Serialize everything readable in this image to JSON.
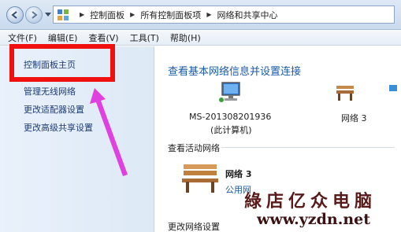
{
  "address_bar": {
    "crumbs": [
      "控制面板",
      "所有控制面板项",
      "网络和共享中心"
    ]
  },
  "menu": [
    "文件(F)",
    "编辑(E)",
    "查看(V)",
    "工具(T)",
    "帮助(H)"
  ],
  "sidebar": {
    "items": [
      {
        "label": "控制面板主页"
      },
      {
        "label": "管理无线网络"
      },
      {
        "label": "更改适配器设置"
      },
      {
        "label": "更改高级共享设置"
      }
    ]
  },
  "main": {
    "title": "查看基本网络信息并设置连接",
    "computer_name": "MS-201308201936",
    "computer_sub": "(此计算机)",
    "network_top": "网络  3",
    "active_label": "查看活动网络",
    "active_network": {
      "name": "网络  3",
      "type": "公用网"
    },
    "bottom_label": "更改网络设置"
  },
  "watermark": {
    "text": "綠店亿众电脑",
    "url": "www.yzdn.net"
  },
  "colors": {
    "accent_link": "#1a5aa8",
    "highlight": "#f01010",
    "arrow": "#e040e0"
  }
}
